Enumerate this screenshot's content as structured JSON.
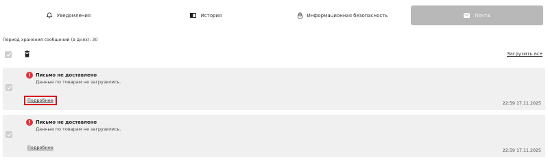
{
  "tabs": [
    {
      "label": "Уведомления",
      "icon": "bell-icon"
    },
    {
      "label": "История",
      "icon": "history-icon"
    },
    {
      "label": "Информационная безопасность",
      "icon": "lock-icon"
    },
    {
      "label": "Почта",
      "icon": "mail-icon",
      "active": true
    }
  ],
  "retention_text": "Период хранения сообщений (в днях): 30",
  "toolbar": {
    "load_all": "Загрузить все"
  },
  "messages": [
    {
      "title": "Письмо не доставлено",
      "description": "Данные по товарам не загрузились.",
      "more_label": "Подробнее",
      "timestamp": "22:59 17.11.2025",
      "highlighted": true
    },
    {
      "title": "Письмо не доставлено",
      "description": "Данные по товарам не загрузились.",
      "more_label": "Подробнее",
      "timestamp": "22:59 17.11.2025",
      "highlighted": false
    }
  ],
  "colors": {
    "accent_error": "#e0303a",
    "active_tab": "#b8b8b8",
    "card_bg": "#f0f0f0",
    "highlight_border": "#d6001c"
  }
}
